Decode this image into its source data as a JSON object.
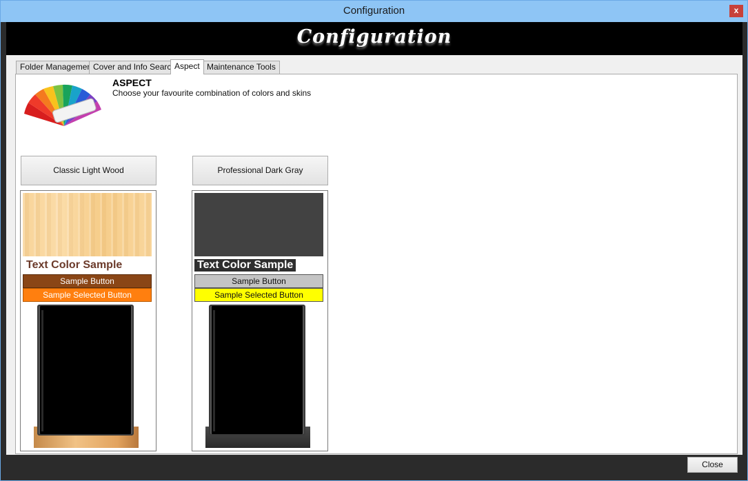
{
  "window": {
    "title": "Configuration",
    "close_glyph": "x"
  },
  "banner": {
    "title": "Configuration"
  },
  "tabs": [
    {
      "label": "Folder Management",
      "active": false
    },
    {
      "label": "Cover and Info Search",
      "active": false
    },
    {
      "label": "Aspect",
      "active": true
    },
    {
      "label": "Maintenance Tools",
      "active": false
    }
  ],
  "aspect": {
    "heading": "ASPECT",
    "description": "Choose your favourite combination of colors and skins",
    "icon": "color-palette-icon"
  },
  "skins": [
    {
      "name": "Classic Light Wood",
      "text_sample": "Text Color Sample",
      "button_label": "Sample Button",
      "selected_button_label": "Sample Selected Button",
      "colors": {
        "text": "#6b3a2a",
        "button": "#8a4616",
        "selected_button": "#ff7f0f"
      }
    },
    {
      "name": "Professional Dark Gray",
      "text_sample": "Text Color Sample",
      "button_label": "Sample Button",
      "selected_button_label": "Sample Selected Button",
      "colors": {
        "text": "#ffffff",
        "button": "#c4c4c4",
        "selected_button": "#ffff00"
      }
    }
  ],
  "footer": {
    "close_label": "Close"
  }
}
